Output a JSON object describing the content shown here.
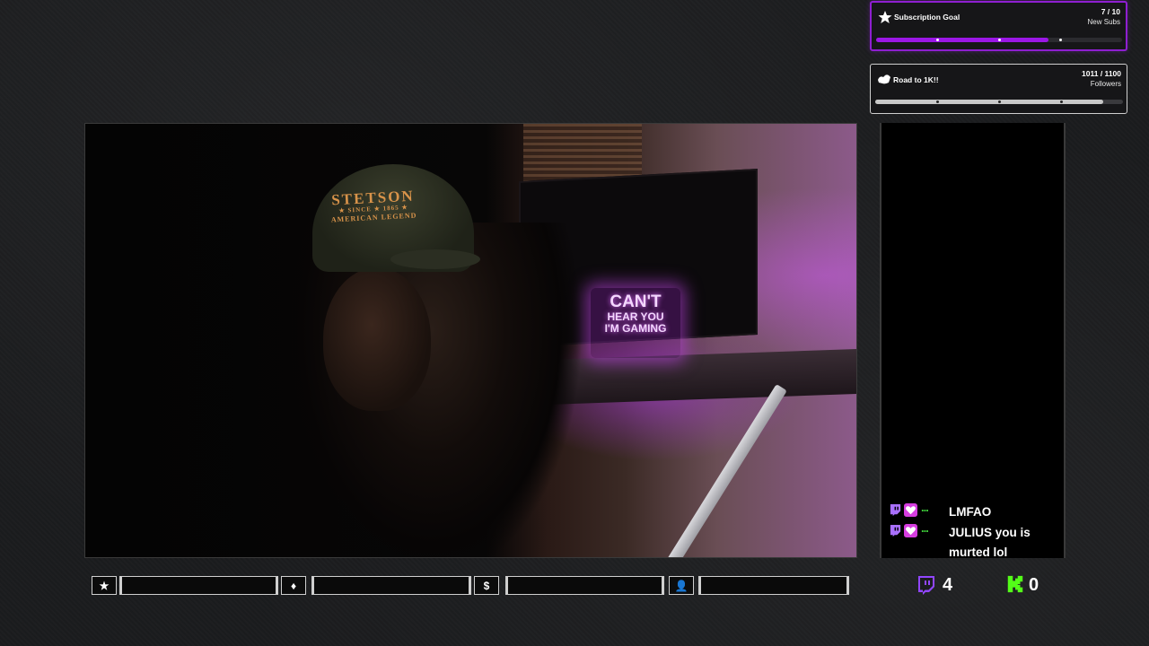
{
  "goals": {
    "subscription": {
      "icon": "star-badge-icon",
      "title": "Subscription Goal",
      "count": "7 / 10",
      "unit": "New Subs",
      "progress": 0.7,
      "accent": "#9b17e6"
    },
    "followers": {
      "icon": "hands-icon",
      "title": "Road to 1K!!",
      "count": "1011 / 1100",
      "unit": "Followers",
      "progress": 0.919,
      "accent": "#c8c8c8"
    }
  },
  "webcam": {
    "cap_brand": "STETSON",
    "cap_since": "★ SINCE ★ 1865 ★",
    "cap_motto": "AMERICAN LEGEND",
    "neon_line1": "CAN'T",
    "neon_line2": "HEAR YOU",
    "neon_line3": "I'M GAMING"
  },
  "chat": {
    "messages": [
      {
        "text": "LMFAO"
      },
      {
        "text": "JULIUS you is murted lol"
      }
    ]
  },
  "statbar": {
    "items": [
      {
        "icon": "star-icon",
        "glyph": "★",
        "value": ""
      },
      {
        "icon": "diamond-icon",
        "glyph": "♦",
        "value": ""
      },
      {
        "icon": "dollar-icon",
        "glyph": "$",
        "value": ""
      },
      {
        "icon": "user-icon",
        "glyph": "👤",
        "value": ""
      }
    ]
  },
  "counters": {
    "twitch": {
      "icon": "twitch-icon",
      "value": "4",
      "color": "#9146ff"
    },
    "kick": {
      "icon": "kick-icon",
      "value": "0",
      "color": "#53fc18"
    }
  }
}
